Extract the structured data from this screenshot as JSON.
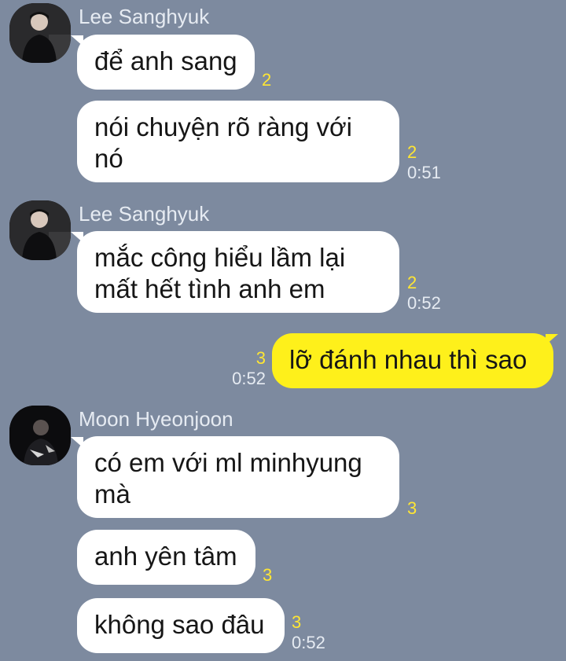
{
  "messages": [
    {
      "sender": "Lee Sanghyuk",
      "text": "để anh sang",
      "count": "2"
    },
    {
      "text": "nói chuyện rõ ràng với\nnó",
      "count": "2",
      "time": "0:51"
    },
    {
      "sender": "Lee Sanghyuk",
      "text": "mắc công hiểu lầm lại\nmất hết tình anh em",
      "count": "2",
      "time": "0:52"
    },
    {
      "text": "lỡ đánh nhau thì sao",
      "count": "3",
      "time": "0:52",
      "mine": true
    },
    {
      "sender": "Moon Hyeonjoon",
      "text": "có em với ml minhyung\nmà",
      "count": "3"
    },
    {
      "text": "anh yên tâm",
      "count": "3"
    },
    {
      "text": "không sao đâu",
      "count": "3",
      "time": "0:52"
    }
  ]
}
